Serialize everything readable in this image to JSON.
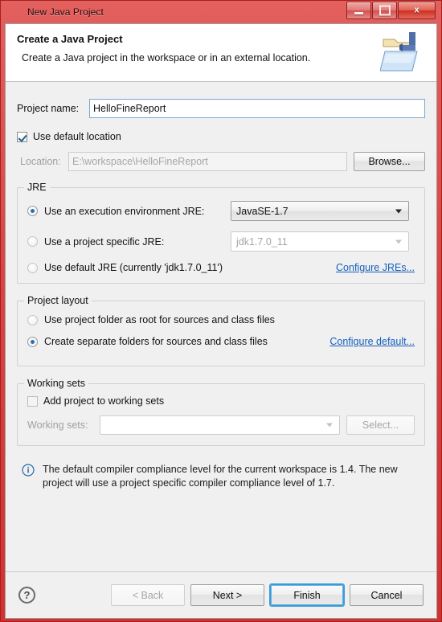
{
  "window": {
    "title": "New Java Project",
    "icon": "java-globe-icon",
    "controls": {
      "minimize": "minimize-button",
      "maximize": "maximize-button",
      "close_label": "x"
    },
    "accent_red": "#d94442",
    "titlebar_gradient_top": "#e2605e",
    "titlebar_gradient_bottom": "#cf3330"
  },
  "header": {
    "title": "Create a Java Project",
    "subtitle": "Create a Java project in the workspace or in an external location.",
    "icon": "java-project-folder-icon"
  },
  "project": {
    "name_label": "Project name:",
    "name_value": "HelloFineReport",
    "name_placeholder": "",
    "use_default_location_label": "Use default location",
    "use_default_location_checked": true,
    "location_label": "Location:",
    "location_value": "E:\\workspace\\HelloFineReport",
    "browse_label": "Browse..."
  },
  "jre": {
    "group_title": "JRE",
    "options": [
      {
        "label": "Use an execution environment JRE:",
        "selected": true
      },
      {
        "label": "Use a project specific JRE:",
        "selected": false
      },
      {
        "label": "Use default JRE (currently 'jdk1.7.0_11')",
        "selected": false
      }
    ],
    "execution_env_value": "JavaSE-1.7",
    "specific_jre_value": "jdk1.7.0_11",
    "configure_link": "Configure JREs...",
    "link_color": "#1560bd"
  },
  "layout": {
    "group_title": "Project layout",
    "options": [
      {
        "label": "Use project folder as root for sources and class files",
        "selected": false
      },
      {
        "label": "Create separate folders for sources and class files",
        "selected": true
      }
    ],
    "configure_link": "Configure default..."
  },
  "working_sets": {
    "group_title": "Working sets",
    "add_label": "Add project to working sets",
    "add_checked": false,
    "sets_label": "Working sets:",
    "sets_value": "",
    "select_label": "Select..."
  },
  "info": {
    "icon": "info-circle-icon",
    "message": "The default compiler compliance level for the current workspace is 1.4. The new project will use a project specific compiler compliance level of 1.7."
  },
  "footer": {
    "help_label": "?",
    "buttons": [
      {
        "label": "< Back",
        "state": "disabled"
      },
      {
        "label": "Next >",
        "state": "enabled"
      },
      {
        "label": "Finish",
        "state": "focused"
      },
      {
        "label": "Cancel",
        "state": "enabled"
      }
    ]
  }
}
